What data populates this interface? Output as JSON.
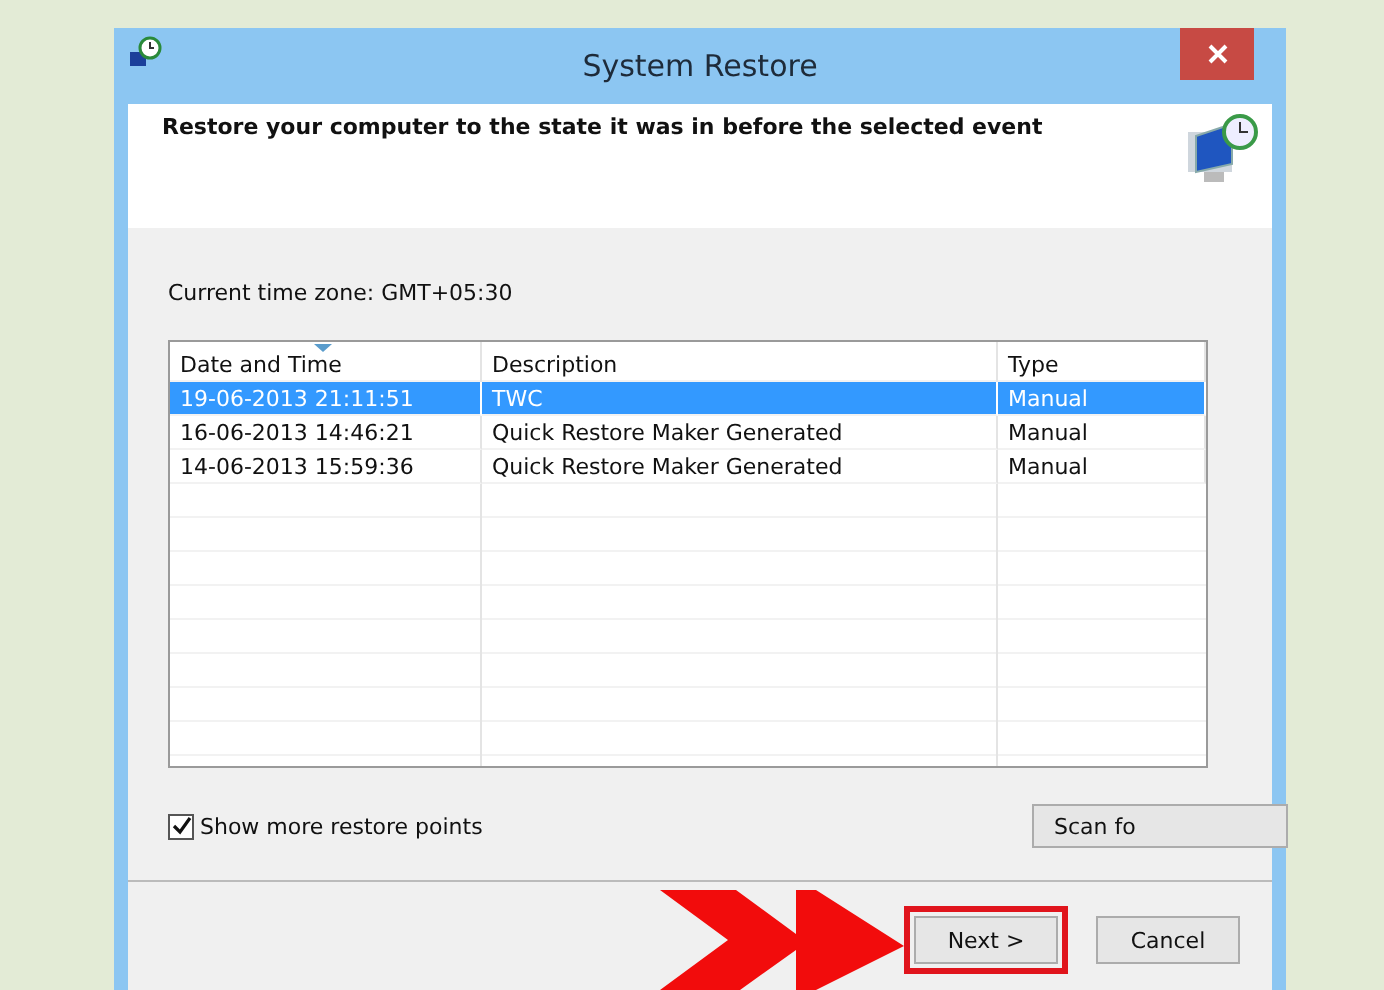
{
  "window": {
    "title": "System Restore"
  },
  "header": {
    "text": "Restore your computer to the state it was in before the selected event"
  },
  "timezone": "Current time zone: GMT+05:30",
  "table": {
    "columns": [
      "Date and Time",
      "Description",
      "Type"
    ],
    "rows": [
      {
        "cells": [
          "19-06-2013 21:11:51",
          "TWC",
          "Manual"
        ],
        "selected": true
      },
      {
        "cells": [
          "16-06-2013 14:46:21",
          "Quick Restore Maker Generated",
          "Manual"
        ],
        "selected": false
      },
      {
        "cells": [
          "14-06-2013 15:59:36",
          "Quick Restore Maker Generated",
          "Manual"
        ],
        "selected": false
      }
    ]
  },
  "show_more": {
    "label": "Show more restore points",
    "checked": true
  },
  "scan_button": "Scan fo",
  "buttons": [
    {
      "label": "Next >",
      "highlighted": true
    },
    {
      "label": "Cancel",
      "highlighted": false
    }
  ]
}
